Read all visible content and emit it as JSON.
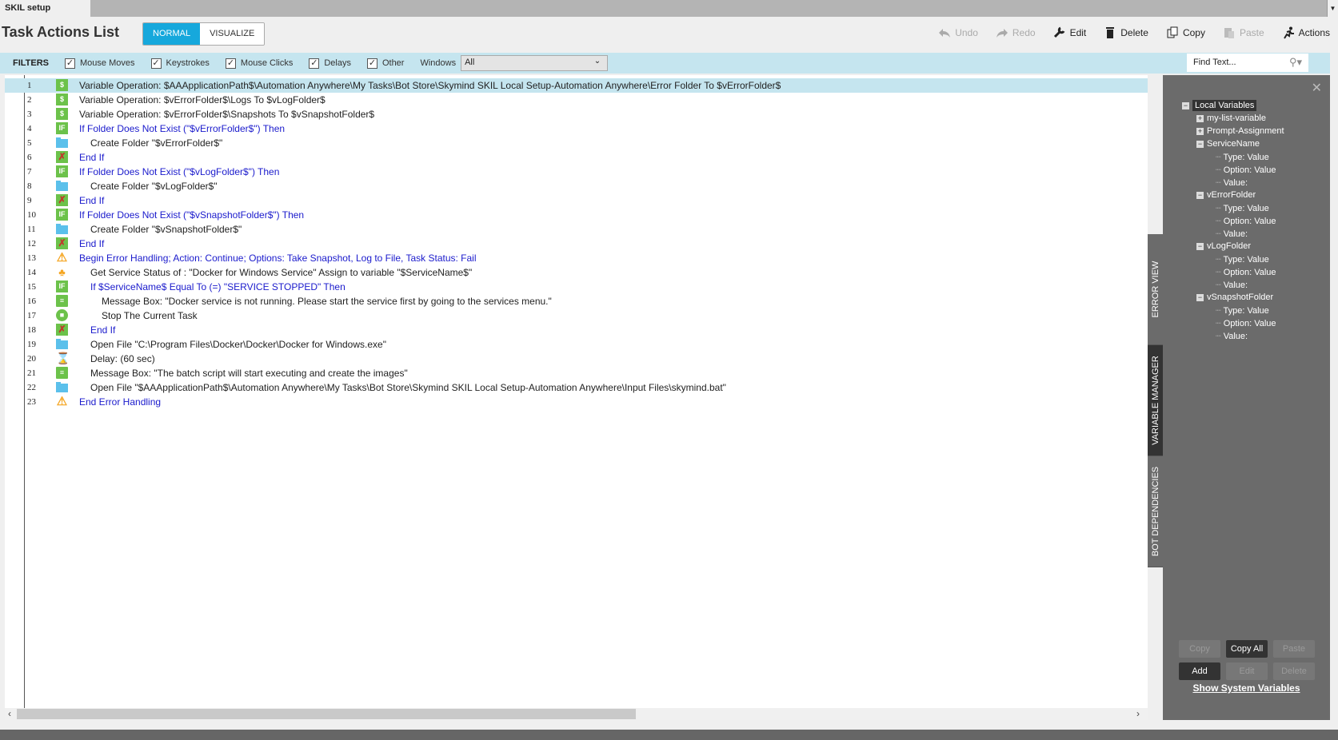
{
  "tab": {
    "label": "SKIL setup"
  },
  "header": {
    "title": "Task Actions List",
    "modes": [
      "NORMAL",
      "VISUALIZE"
    ],
    "active_mode": "NORMAL"
  },
  "toolbar": {
    "undo": "Undo",
    "redo": "Redo",
    "edit": "Edit",
    "delete": "Delete",
    "copy": "Copy",
    "paste": "Paste",
    "actions": "Actions"
  },
  "filters": {
    "label": "FILTERS",
    "items": [
      "Mouse Moves",
      "Keystrokes",
      "Mouse Clicks",
      "Delays",
      "Other"
    ],
    "windows_label": "Windows",
    "windows_value": "All",
    "find_placeholder": "Find Text..."
  },
  "actions": [
    {
      "n": "1",
      "icon": "dollar",
      "indent": 0,
      "blue": false,
      "text": "Variable Operation: $AAApplicationPath$\\Automation Anywhere\\My Tasks\\Bot Store\\Skymind SKIL Local Setup-Automation Anywhere\\Error Folder To $vErrorFolder$"
    },
    {
      "n": "2",
      "icon": "dollar",
      "indent": 0,
      "blue": false,
      "text": "Variable Operation: $vErrorFolder$\\Logs To $vLogFolder$"
    },
    {
      "n": "3",
      "icon": "dollar",
      "indent": 0,
      "blue": false,
      "text": "Variable Operation: $vErrorFolder$\\Snapshots To $vSnapshotFolder$"
    },
    {
      "n": "4",
      "icon": "if",
      "indent": 0,
      "blue": true,
      "text": "If Folder Does Not Exist (\"$vErrorFolder$\")  Then"
    },
    {
      "n": "5",
      "icon": "folder",
      "indent": 1,
      "blue": false,
      "text": "Create Folder \"$vErrorFolder$\""
    },
    {
      "n": "6",
      "icon": "endif",
      "indent": 0,
      "blue": true,
      "text": "End If"
    },
    {
      "n": "7",
      "icon": "if",
      "indent": 0,
      "blue": true,
      "text": "If Folder Does Not Exist (\"$vLogFolder$\")  Then"
    },
    {
      "n": "8",
      "icon": "folder",
      "indent": 1,
      "blue": false,
      "text": "Create Folder \"$vLogFolder$\""
    },
    {
      "n": "9",
      "icon": "endif",
      "indent": 0,
      "blue": true,
      "text": "End If"
    },
    {
      "n": "10",
      "icon": "if",
      "indent": 0,
      "blue": true,
      "text": "If Folder Does Not Exist (\"$vSnapshotFolder$\")  Then"
    },
    {
      "n": "11",
      "icon": "folder",
      "indent": 1,
      "blue": false,
      "text": "Create Folder \"$vSnapshotFolder$\""
    },
    {
      "n": "12",
      "icon": "endif",
      "indent": 0,
      "blue": true,
      "text": "End If"
    },
    {
      "n": "13",
      "icon": "warning",
      "indent": 0,
      "blue": true,
      "text": "Begin Error Handling; Action: Continue; Options: Take Snapshot, Log to File,  Task Status: Fail"
    },
    {
      "n": "14",
      "icon": "service",
      "indent": 1,
      "blue": false,
      "text": "Get Service Status of : \"Docker for Windows Service\" Assign to variable \"$ServiceName$\""
    },
    {
      "n": "15",
      "icon": "if",
      "indent": 1,
      "blue": true,
      "text": "If $ServiceName$ Equal To (=) \"SERVICE STOPPED\" Then"
    },
    {
      "n": "16",
      "icon": "message",
      "indent": 2,
      "blue": false,
      "text": "Message Box: \"Docker service is not running. Please start the service first by going to the services menu.\""
    },
    {
      "n": "17",
      "icon": "stop",
      "indent": 2,
      "blue": false,
      "text": "Stop The Current Task"
    },
    {
      "n": "18",
      "icon": "endif",
      "indent": 1,
      "blue": true,
      "text": "End If"
    },
    {
      "n": "19",
      "icon": "folder",
      "indent": 1,
      "blue": false,
      "text": "Open File \"C:\\Program Files\\Docker\\Docker\\Docker for Windows.exe\""
    },
    {
      "n": "20",
      "icon": "delay",
      "indent": 1,
      "blue": false,
      "text": "Delay: (60 sec)"
    },
    {
      "n": "21",
      "icon": "message",
      "indent": 1,
      "blue": false,
      "text": "Message Box: \"The batch script will start executing and create the images\""
    },
    {
      "n": "22",
      "icon": "folder",
      "indent": 1,
      "blue": false,
      "text": "Open File \"$AAApplicationPath$\\Automation Anywhere\\My Tasks\\Bot Store\\Skymind SKIL Local Setup-Automation Anywhere\\Input Files\\skymind.bat\""
    },
    {
      "n": "23",
      "icon": "warning",
      "indent": 0,
      "blue": true,
      "text": "End Error Handling"
    }
  ],
  "side_tabs": [
    "ERROR VIEW",
    "VARIABLE MANAGER",
    "BOT DEPENDENCIES"
  ],
  "variables": {
    "root": "Local Variables",
    "tree": [
      {
        "label": "my-list-variable",
        "level": 1,
        "sign": "+"
      },
      {
        "label": "Prompt-Assignment",
        "level": 1,
        "sign": "+"
      },
      {
        "label": "ServiceName",
        "level": 1,
        "sign": "-"
      },
      {
        "label": "Type: Value",
        "level": 2
      },
      {
        "label": "Option: Value",
        "level": 2
      },
      {
        "label": "Value:",
        "level": 2
      },
      {
        "label": "vErrorFolder",
        "level": 1,
        "sign": "-"
      },
      {
        "label": "Type: Value",
        "level": 2
      },
      {
        "label": "Option: Value",
        "level": 2
      },
      {
        "label": "Value:",
        "level": 2
      },
      {
        "label": "vLogFolder",
        "level": 1,
        "sign": "-"
      },
      {
        "label": "Type: Value",
        "level": 2
      },
      {
        "label": "Option: Value",
        "level": 2
      },
      {
        "label": "Value:",
        "level": 2
      },
      {
        "label": "vSnapshotFolder",
        "level": 1,
        "sign": "-"
      },
      {
        "label": "Type: Value",
        "level": 2
      },
      {
        "label": "Option: Value",
        "level": 2
      },
      {
        "label": "Value:",
        "level": 2
      }
    ],
    "buttons": {
      "copy": "Copy",
      "copy_all": "Copy All",
      "paste": "Paste",
      "add": "Add",
      "edit": "Edit",
      "delete": "Delete"
    },
    "show_system": "Show System Variables"
  }
}
